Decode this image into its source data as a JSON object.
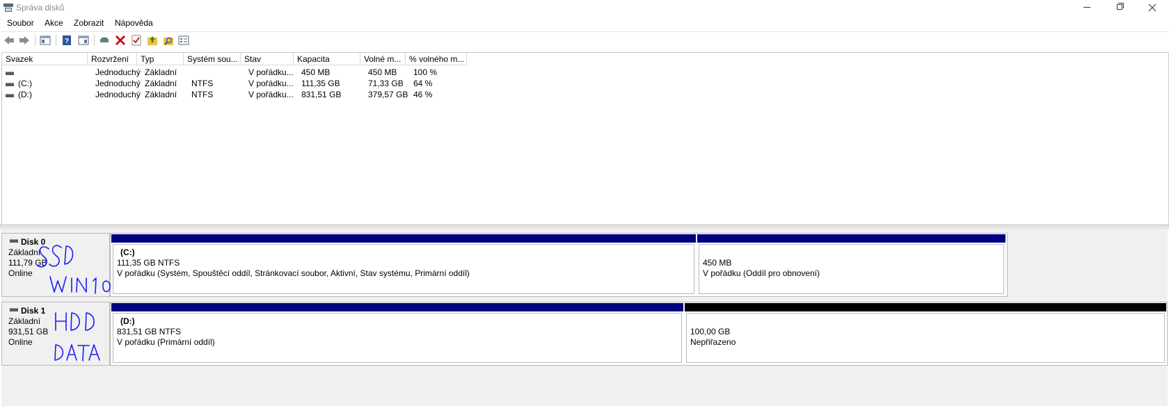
{
  "window": {
    "title": "Správa disků"
  },
  "menu": [
    "Soubor",
    "Akce",
    "Zobrazit",
    "Nápověda"
  ],
  "toolbar": {
    "icons": [
      "back-icon",
      "forward-icon",
      "console-tree-icon",
      "help-icon",
      "action-pane-icon",
      "connect-disk-icon",
      "delete-icon",
      "properties-icon",
      "export-icon",
      "rescan-icon",
      "settings-icon"
    ],
    "colors": {
      "delete": "#cc1111",
      "help": "#2b579a",
      "folder": "#f0c040"
    }
  },
  "list": {
    "headers": [
      "Svazek",
      "Rozvržení",
      "Typ",
      "Systém sou...",
      "Stav",
      "Kapacita",
      "Volné m...",
      "% volného m..."
    ],
    "rows": [
      [
        "",
        "Jednoduchý",
        "Základní",
        "",
        "V pořádku...",
        "450 MB",
        "450 MB",
        "100 %"
      ],
      [
        "(C:)",
        "Jednoduchý",
        "Základní",
        "NTFS",
        "V pořádku...",
        "111,35 GB",
        "71,33 GB",
        "64 %"
      ],
      [
        "(D:)",
        "Jednoduchý",
        "Základní",
        "NTFS",
        "V pořádku...",
        "831,51 GB",
        "379,57 GB",
        "46 %"
      ]
    ]
  },
  "disks": [
    {
      "name": "Disk 0",
      "type": "Základní",
      "size": "111,79 GB",
      "status": "Online",
      "annotation": [
        "SSD",
        "WIN 10"
      ],
      "partitions": [
        {
          "name": "(C:)",
          "size": "111,35 GB NTFS",
          "status": "V pořádku (Systém, Spouštěcí oddíl, Stránkovací soubor, Aktivní, Stav systému, Primární oddíl)",
          "bar_color": "#00007f"
        },
        {
          "name": "",
          "size": "450 MB",
          "status": "V pořádku (Oddíl pro obnovení)",
          "bar_color": "#00007f"
        }
      ]
    },
    {
      "name": "Disk 1",
      "type": "Základní",
      "size": "931,51 GB",
      "status": "Online",
      "annotation": [
        "HDD",
        "DATA"
      ],
      "partitions": [
        {
          "name": "(D:)",
          "size": "831,51 GB NTFS",
          "status": "V pořádku (Primární oddíl)",
          "bar_color": "#00007f"
        },
        {
          "name": "",
          "size": "100,00 GB",
          "status": "Nepřiřazeno",
          "bar_color": "#000000"
        }
      ]
    }
  ],
  "annotation_color": "#1a1aff"
}
